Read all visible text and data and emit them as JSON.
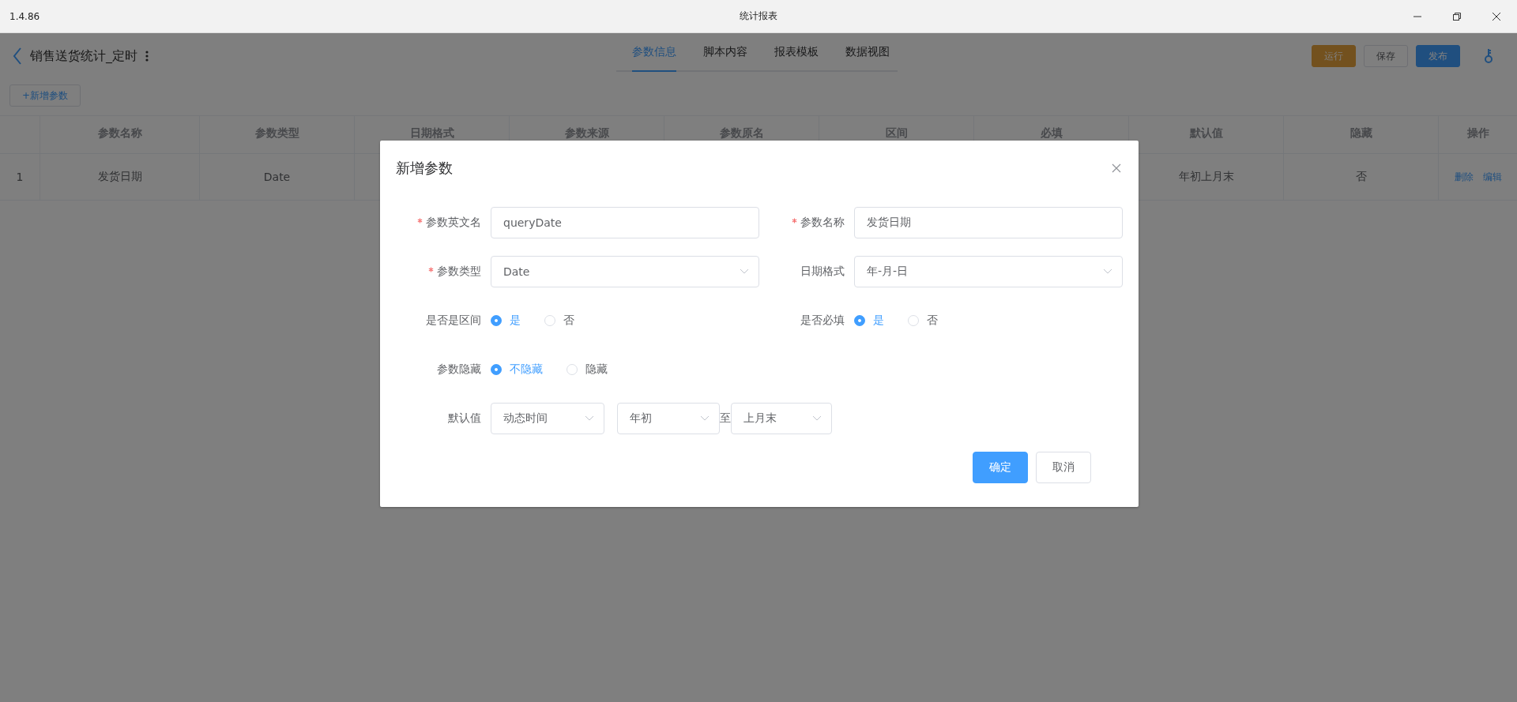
{
  "app": {
    "version": "1.4.86",
    "title": "统计报表"
  },
  "header": {
    "title": "销售送货统计_定时",
    "tabs": [
      {
        "label": "参数信息",
        "selected": true
      },
      {
        "label": "脚本内容",
        "selected": false
      },
      {
        "label": "报表模板",
        "selected": false
      },
      {
        "label": "数据视图",
        "selected": false
      }
    ],
    "actions": [
      {
        "label": "运行",
        "kind": "warning"
      },
      {
        "label": "保存",
        "kind": "plain"
      },
      {
        "label": "发布",
        "kind": "primary"
      }
    ]
  },
  "toolbar": {
    "add_button": "+新增参数"
  },
  "table": {
    "columns": [
      "参数名称",
      "参数类型",
      "日期格式",
      "参数来源",
      "参数原名",
      "区间",
      "必填",
      "默认值",
      "隐藏",
      "操作"
    ],
    "rows": [
      {
        "index": "1",
        "param_name": "发货日期",
        "param_type": "Date",
        "default_value": "年初上月末",
        "hidden": "否",
        "actions": [
          "删除",
          "编辑"
        ]
      }
    ]
  },
  "dialog": {
    "title": "新增参数",
    "rows": [
      [
        {
          "kind": "input",
          "label": "参数英文名",
          "required": true,
          "value": "queryDate"
        },
        {
          "kind": "input",
          "label": "参数名称",
          "required": true,
          "value": "发货日期"
        }
      ],
      [
        {
          "kind": "select",
          "label": "参数类型",
          "required": true,
          "value": "Date"
        },
        {
          "kind": "select",
          "label": "日期格式",
          "required": false,
          "value": "年-月-日"
        }
      ],
      [
        {
          "kind": "radio",
          "label": "是否是区间",
          "options": [
            {
              "label": "是",
              "selected": true
            },
            {
              "label": "否",
              "selected": false
            }
          ]
        },
        {
          "kind": "radio",
          "label": "是否必填",
          "options": [
            {
              "label": "是",
              "selected": true
            },
            {
              "label": "否",
              "selected": false
            }
          ]
        }
      ],
      [
        {
          "kind": "radio",
          "label": "参数隐藏",
          "options": [
            {
              "label": "不隐藏",
              "selected": true
            },
            {
              "label": "隐藏",
              "selected": false
            }
          ]
        }
      ],
      [
        {
          "kind": "range",
          "label": "默认值",
          "selects": [
            "动态时间",
            "年初",
            "上月末"
          ],
          "separator": "至"
        }
      ]
    ],
    "buttons": [
      {
        "label": "确定",
        "kind": "primary"
      },
      {
        "label": "取消",
        "kind": "plain"
      }
    ]
  }
}
